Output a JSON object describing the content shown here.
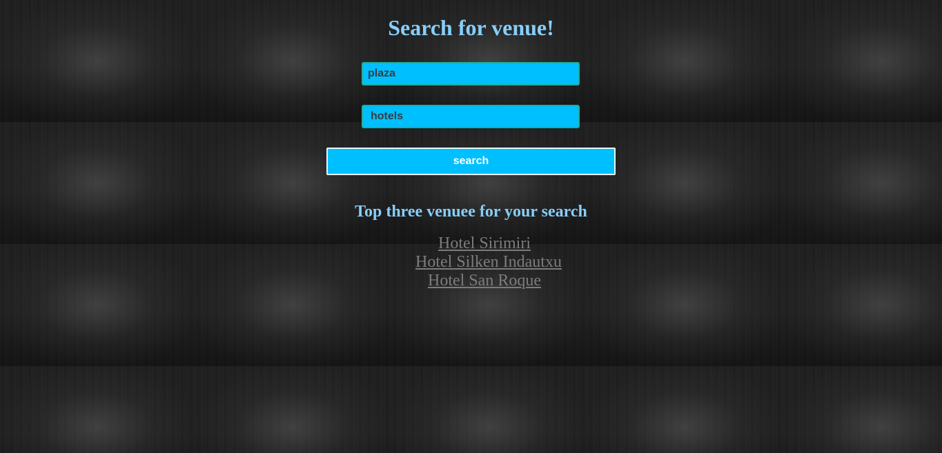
{
  "page": {
    "title": "Search for venue!"
  },
  "form": {
    "venue_value": "plaza",
    "type_value": "hotels",
    "search_label": "search"
  },
  "results": {
    "heading": "Top three venuee for your search",
    "items": [
      {
        "label": "Hotel Sirimiri"
      },
      {
        "label": "Hotel Silken Indautxu"
      },
      {
        "label": "Hotel San Roque"
      }
    ]
  },
  "colors": {
    "title": "#87cefa",
    "field_background": "#00bfff",
    "link": "#7c7c7c",
    "background": "#1f1f1f"
  }
}
